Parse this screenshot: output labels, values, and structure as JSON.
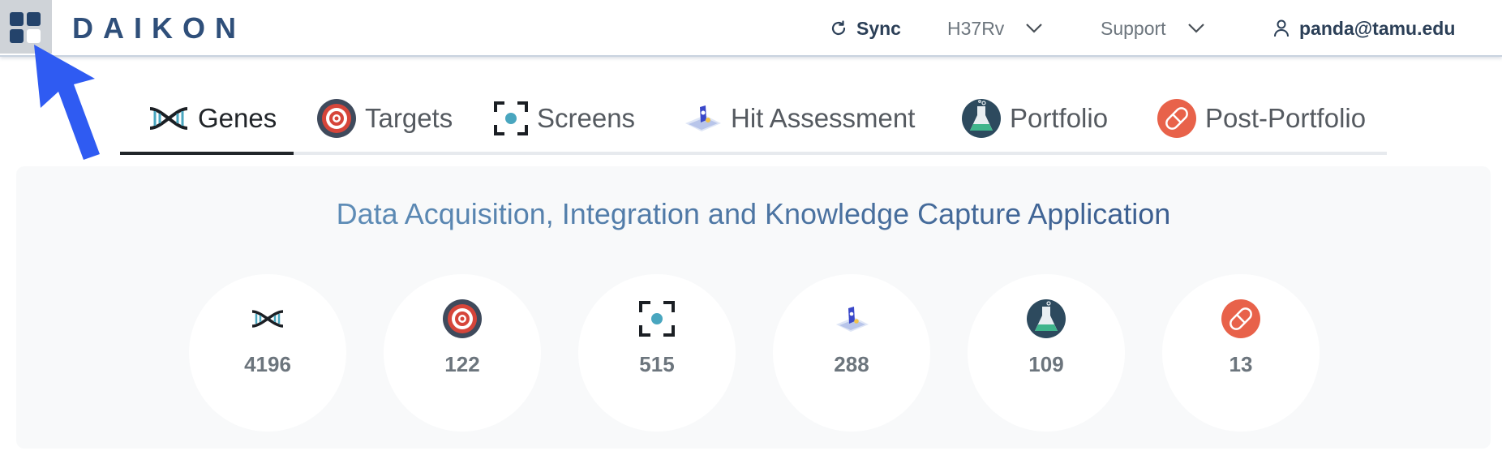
{
  "app": {
    "brand": "DAIKON"
  },
  "header": {
    "sync_label": "Sync",
    "organism": "H37Rv",
    "support_label": "Support",
    "user_email": "panda@tamu.edu"
  },
  "tabs": [
    {
      "label": "Genes",
      "icon": "dna-icon",
      "active": true
    },
    {
      "label": "Targets",
      "icon": "target-icon"
    },
    {
      "label": "Screens",
      "icon": "screen-icon"
    },
    {
      "label": "Hit Assessment",
      "icon": "hit-assessment-icon"
    },
    {
      "label": "Portfolio",
      "icon": "flask-icon"
    },
    {
      "label": "Post-Portfolio",
      "icon": "pill-icon"
    }
  ],
  "main": {
    "headline": "Data Acquisition, Integration and Knowledge Capture Application",
    "stats": [
      {
        "icon": "dna-icon",
        "value": "4196"
      },
      {
        "icon": "target-icon",
        "value": "122"
      },
      {
        "icon": "screen-icon",
        "value": "515"
      },
      {
        "icon": "hit-assessment-icon",
        "value": "288"
      },
      {
        "icon": "flask-icon",
        "value": "109"
      },
      {
        "icon": "pill-icon",
        "value": "13"
      }
    ]
  },
  "colors": {
    "brand": "#2f4f7a",
    "arrow": "#2f5bf2",
    "target_red": "#d6453a",
    "pill_orange": "#e8624a",
    "flask_dark": "#2d4a5e",
    "flask_green": "#3fb58c",
    "screen_teal": "#49a6bf"
  }
}
